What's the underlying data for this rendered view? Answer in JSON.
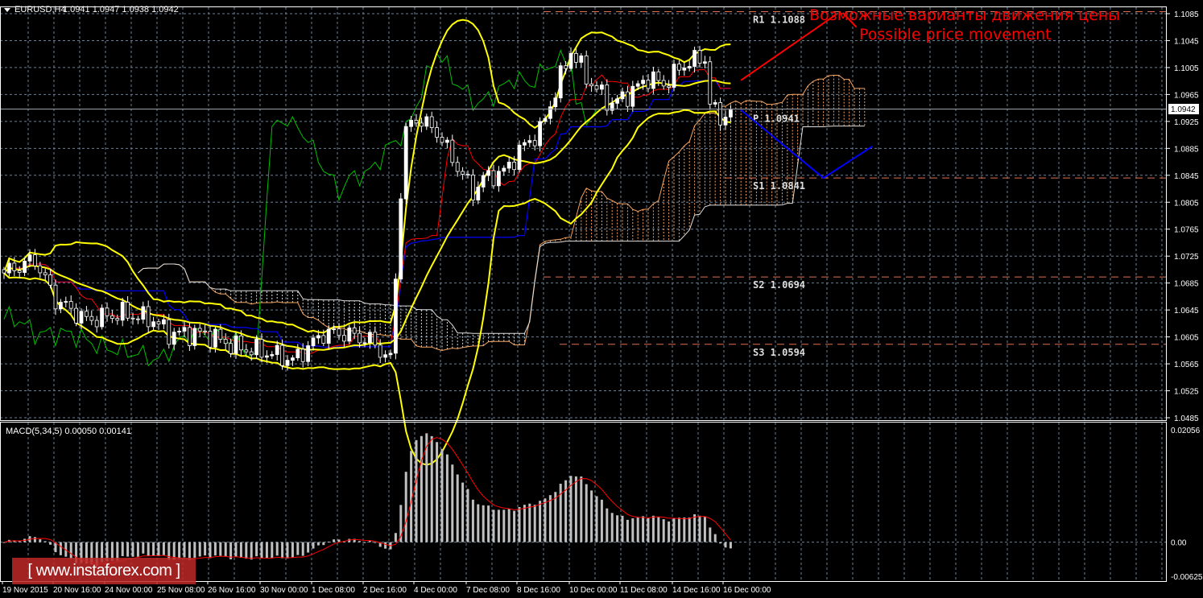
{
  "header": {
    "symbol": "EURUSD,H4",
    "ohlc": "1.0941 1.0947 1.0938 1.0942"
  },
  "macd_header": {
    "label": "MACD(5,34,5) 0.00050 0.00141"
  },
  "annotation": {
    "ru": "Возможные варианты движения цены",
    "en": "Possible price movement"
  },
  "watermark": "[ www.instaforex.com ]",
  "colors": {
    "bg": "#000000",
    "grid": "#6e7f90",
    "bollinger": "#ffff00",
    "tenkan": "#ff0000",
    "kijun": "#0000ff",
    "chikou": "#00c000",
    "pivot": "#e07050",
    "macd_hist": "#c0c0c0",
    "macd_signal": "#ff0000",
    "projection": "#0000ff",
    "arrow": "#ff0000"
  },
  "chart_data": {
    "type": "candlestick",
    "title": "EURUSD,H4",
    "ylim": [
      1.0485,
      1.1085
    ],
    "current_price": "1.0942",
    "price_ticks": [
      "1.1085",
      "1.1045",
      "1.1005",
      "1.0965",
      "1.0925",
      "1.0885",
      "1.0845",
      "1.0805",
      "1.0765",
      "1.0725",
      "1.0685",
      "1.0645",
      "1.0605",
      "1.0565",
      "1.0525",
      "1.0485"
    ],
    "time_labels": [
      "19 Nov 2015",
      "20 Nov 16:00",
      "24 Nov 00:00",
      "25 Nov 08:00",
      "26 Nov 16:00",
      "30 Nov 00:00",
      "1 Dec 08:00",
      "2 Dec 16:00",
      "4 Dec 00:00",
      "7 Dec 08:00",
      "8 Dec 16:00",
      "10 Dec 00:00",
      "11 Dec 08:00",
      "14 Dec 16:00",
      "16 Dec 00:00"
    ],
    "bar_count": 142,
    "close_keypoints": [
      [
        0,
        1.07
      ],
      [
        6,
        1.072
      ],
      [
        10,
        1.066
      ],
      [
        16,
        1.063
      ],
      [
        23,
        1.064
      ],
      [
        29,
        1.063
      ],
      [
        32,
        1.061
      ],
      [
        39,
        1.061
      ],
      [
        45,
        1.059
      ],
      [
        52,
        1.058
      ],
      [
        56,
        1.057
      ],
      [
        62,
        1.061
      ],
      [
        66,
        1.061
      ],
      [
        71,
        1.06
      ],
      [
        75,
        1.057
      ],
      [
        77,
        1.082
      ],
      [
        78,
        1.091
      ],
      [
        80,
        1.093
      ],
      [
        84,
        1.091
      ],
      [
        87,
        1.087
      ],
      [
        91,
        1.082
      ],
      [
        93,
        1.084
      ],
      [
        97,
        1.085
      ],
      [
        101,
        1.089
      ],
      [
        104,
        1.091
      ],
      [
        108,
        1.099
      ],
      [
        110,
        1.103
      ],
      [
        114,
        1.098
      ],
      [
        118,
        1.095
      ],
      [
        122,
        1.097
      ],
      [
        125,
        1.099
      ],
      [
        128,
        1.098
      ],
      [
        132,
        1.101
      ],
      [
        136,
        1.102
      ],
      [
        137,
        1.095
      ],
      [
        139,
        1.093
      ],
      [
        141,
        1.0942
      ]
    ],
    "pivots": [
      {
        "name": "R1",
        "value": "1.1088",
        "label": "R1  1.1088"
      },
      {
        "name": "P",
        "value": "1.0941",
        "label": "P  1.0941"
      },
      {
        "name": "S1",
        "value": "1.0841",
        "label": "S1  1.0841"
      },
      {
        "name": "S2",
        "value": "1.0694",
        "label": "S2  1.0694"
      },
      {
        "name": "S3",
        "value": "1.0594",
        "label": "S3  1.0594"
      }
    ],
    "projection": [
      [
        143,
        1.0942
      ],
      [
        159,
        1.0841
      ],
      [
        168.5,
        1.0888
      ]
    ],
    "arrow": [
      [
        143,
        1.0986
      ],
      [
        161.5,
        1.1084
      ]
    ],
    "indicators": {
      "bollinger_period": 20,
      "ichimoku": [
        9,
        26,
        52
      ],
      "macd": [
        5,
        34,
        5
      ]
    },
    "macd": {
      "ylim": [
        -0.00625,
        0.02056
      ],
      "ticks": [
        "0.02056",
        "0.00",
        "-0.00625"
      ]
    }
  }
}
